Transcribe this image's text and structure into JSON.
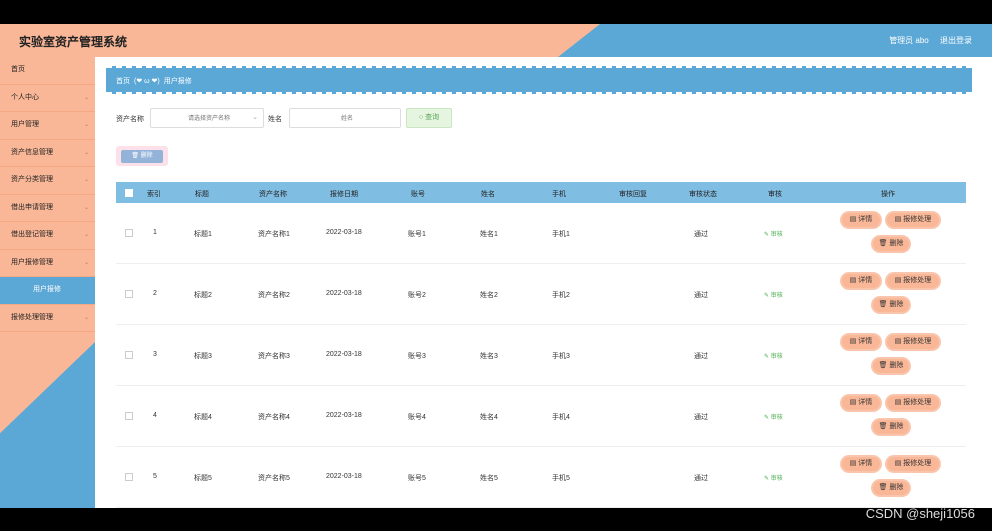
{
  "app": {
    "title": "实验室资产管理系统"
  },
  "header": {
    "user_label": "管理员 abo",
    "logout_label": "退出登录"
  },
  "sidebar": {
    "items": [
      {
        "label": "首页",
        "chevron": false
      },
      {
        "label": "个人中心",
        "chevron": true
      },
      {
        "label": "用户管理",
        "chevron": true
      },
      {
        "label": "资产信息管理",
        "chevron": true
      },
      {
        "label": "资产分类管理",
        "chevron": true
      },
      {
        "label": "借出申请管理",
        "chevron": true
      },
      {
        "label": "借出登记管理",
        "chevron": true
      },
      {
        "label": "用户报修管理",
        "chevron": true
      }
    ],
    "active_sub": "用户报修",
    "last_item": "报修处理管理"
  },
  "breadcrumb": {
    "home": "首页",
    "separator": "(❤ ω ❤)",
    "current": "用户报修"
  },
  "search": {
    "asset_label": "资产名称",
    "asset_placeholder": "请选择资产名称",
    "name_label": "姓名",
    "name_placeholder": "姓名",
    "query_label": "查询"
  },
  "toolbar": {
    "delete_label": "删除"
  },
  "table": {
    "columns": [
      "索引",
      "标题",
      "资产名称",
      "报修日期",
      "账号",
      "姓名",
      "手机",
      "审核回复",
      "审核状态",
      "审核",
      "操作"
    ],
    "audit_link": "审核",
    "btn_detail": "详情",
    "btn_repair": "报修处理",
    "btn_delete": "删除",
    "rows": [
      {
        "index": "1",
        "title": "标题1",
        "asset": "资产名称1",
        "date": "2022-03-18",
        "account": "账号1",
        "name": "姓名1",
        "phone": "手机1",
        "reply": "",
        "status": "通过"
      },
      {
        "index": "2",
        "title": "标题2",
        "asset": "资产名称2",
        "date": "2022-03-18",
        "account": "账号2",
        "name": "姓名2",
        "phone": "手机2",
        "reply": "",
        "status": "通过"
      },
      {
        "index": "3",
        "title": "标题3",
        "asset": "资产名称3",
        "date": "2022-03-18",
        "account": "账号3",
        "name": "姓名3",
        "phone": "手机3",
        "reply": "",
        "status": "通过"
      },
      {
        "index": "4",
        "title": "标题4",
        "asset": "资产名称4",
        "date": "2022-03-18",
        "account": "账号4",
        "name": "姓名4",
        "phone": "手机4",
        "reply": "",
        "status": "通过"
      },
      {
        "index": "5",
        "title": "标题5",
        "asset": "资产名称5",
        "date": "2022-03-18",
        "account": "账号5",
        "name": "姓名5",
        "phone": "手机5",
        "reply": "",
        "status": "通过"
      }
    ]
  },
  "watermark": "CSDN @sheji1056",
  "colors": {
    "accent_blue": "#5ba8d6",
    "accent_peach": "#f9b797",
    "table_header": "#80bde3"
  }
}
